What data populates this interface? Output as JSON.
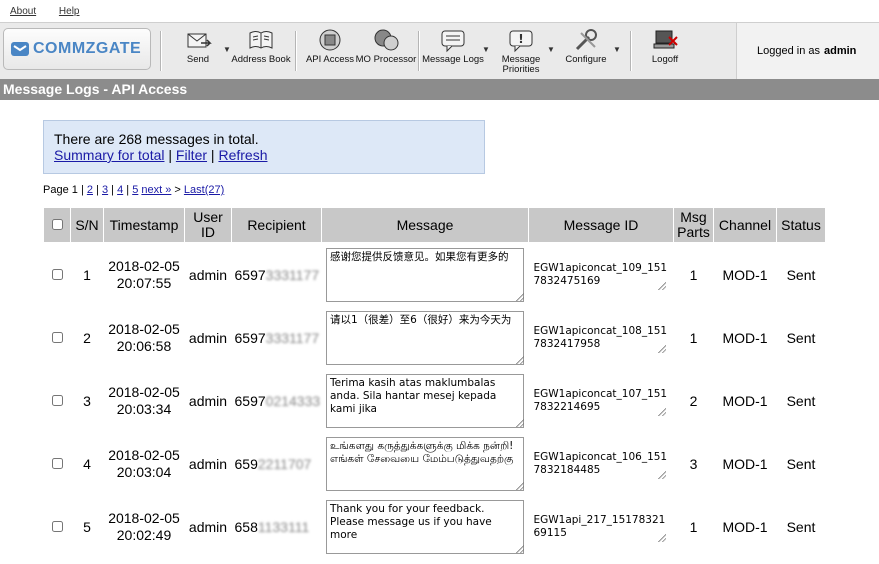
{
  "top_links": [
    "About",
    "Help"
  ],
  "logo": {
    "text": "COMMZGATE",
    "color": "#4a86c5"
  },
  "toolbar": [
    {
      "label": "Send",
      "icon": "send-icon",
      "caret": true
    },
    {
      "label": "Address Book",
      "icon": "address-book-icon",
      "caret": false
    },
    {
      "label": "API Access",
      "icon": "api-access-icon",
      "caret": false
    },
    {
      "label": "MO Processor",
      "icon": "mo-processor-icon",
      "caret": false
    },
    {
      "label": "Message Logs",
      "icon": "message-logs-icon",
      "caret": true
    },
    {
      "label": "Message Priorities",
      "icon": "message-priorities-icon",
      "caret": true
    },
    {
      "label": "Configure",
      "icon": "configure-icon",
      "caret": true
    },
    {
      "label": "Logoff",
      "icon": "logoff-icon",
      "caret": false
    }
  ],
  "login": {
    "prefix": "Logged in as",
    "user": "admin"
  },
  "page_title": "Message Logs - API Access",
  "info": {
    "total_text": "There are 268 messages in total.",
    "summary_link": "Summary for total",
    "filter_link": "Filter",
    "refresh_link": "Refresh",
    "separator": "|"
  },
  "pager": {
    "label": "Page",
    "current": "1",
    "pages": [
      "2",
      "3",
      "4",
      "5"
    ],
    "next": "next »",
    "gt": ">",
    "last": "Last(27)"
  },
  "table": {
    "headers": [
      "S/N",
      "Timestamp",
      "User ID",
      "Recipient",
      "Message",
      "Message ID",
      "Msg Parts",
      "Channel",
      "Status"
    ],
    "rows": [
      {
        "sn": "1",
        "date": "2018-02-05",
        "time": "20:07:55",
        "user": "admin",
        "recipient_visible": "6597",
        "recipient_hidden": "3331177",
        "message": "感谢您提供反馈意见。如果您有更多的",
        "message_id": "EGW1apiconcat_109_1517832475169",
        "parts": "1",
        "channel": "MOD-1",
        "status": "Sent"
      },
      {
        "sn": "2",
        "date": "2018-02-05",
        "time": "20:06:58",
        "user": "admin",
        "recipient_visible": "6597",
        "recipient_hidden": "3331177",
        "message": "请以1（很差）至6（很好）来为今天为",
        "message_id": "EGW1apiconcat_108_1517832417958",
        "parts": "1",
        "channel": "MOD-1",
        "status": "Sent"
      },
      {
        "sn": "3",
        "date": "2018-02-05",
        "time": "20:03:34",
        "user": "admin",
        "recipient_visible": "6597",
        "recipient_hidden": "0214333",
        "message": "Terima kasih atas maklumbalas anda. Sila hantar mesej kepada kami jika",
        "message_id": "EGW1apiconcat_107_1517832214695",
        "parts": "2",
        "channel": "MOD-1",
        "status": "Sent"
      },
      {
        "sn": "4",
        "date": "2018-02-05",
        "time": "20:03:04",
        "user": "admin",
        "recipient_visible": "659",
        "recipient_hidden": "2211707",
        "message": "உங்களது கருத்துக்களுக்கு மிக்க நன்றி! எங்கள் சேவையை மேம்படுத்துவதற்கு",
        "message_id": "EGW1apiconcat_106_1517832184485",
        "parts": "3",
        "channel": "MOD-1",
        "status": "Sent"
      },
      {
        "sn": "5",
        "date": "2018-02-05",
        "time": "20:02:49",
        "user": "admin",
        "recipient_visible": "658",
        "recipient_hidden": "1133111",
        "message": "Thank you for your feedback.  Please message us if you have more",
        "message_id": "EGW1api_217_1517832169115",
        "parts": "1",
        "channel": "MOD-1",
        "status": "Sent"
      }
    ]
  }
}
